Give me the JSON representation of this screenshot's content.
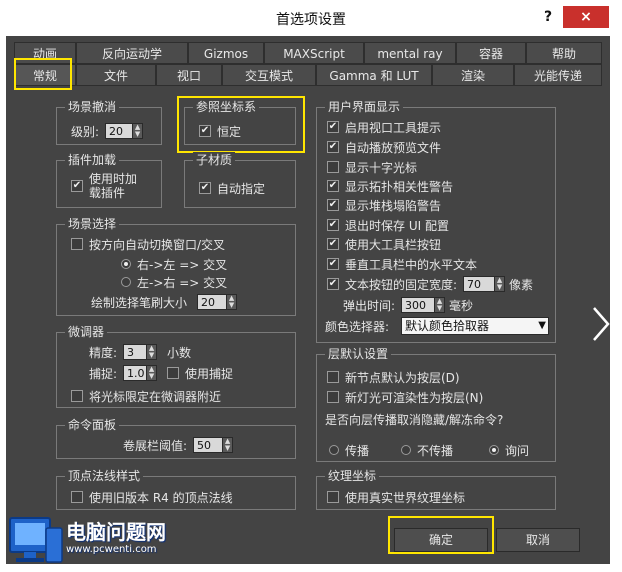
{
  "window": {
    "title": "首选项设置",
    "help_label": "?",
    "close_label": "×"
  },
  "tabs": {
    "row1": [
      "动画",
      "反向运动学",
      "Gizmos",
      "MAXScript",
      "mental ray",
      "容器",
      "帮助"
    ],
    "row2": [
      "常规",
      "文件",
      "视口",
      "交互模式",
      "Gamma 和 LUT",
      "渲染",
      "光能传递"
    ],
    "active": "常规"
  },
  "scene_undo": {
    "title": "场景撤消",
    "level_label": "级别:",
    "level_value": "20"
  },
  "ref_coord": {
    "title": "参照坐标系",
    "constant_label": "恒定",
    "constant_checked": true
  },
  "plugin_load": {
    "title": "插件加载",
    "load_on_use_label_1": "使用时加",
    "load_on_use_label_2": "载插件",
    "checked": true
  },
  "sub_material": {
    "title": "子材质",
    "auto_assign_label": "自动指定",
    "checked": true
  },
  "scene_selection": {
    "title": "场景选择",
    "auto_switch_label": "按方向自动切换窗口/交叉",
    "auto_switch_checked": false,
    "right_left_label": "右->左 => 交叉",
    "left_right_label": "左->右 => 交叉",
    "selected_radio": "right_left",
    "brush_size_label": "绘制选择笔刷大小",
    "brush_size_value": "20"
  },
  "spinners": {
    "title": "微调器",
    "precision_label": "精度:",
    "precision_value": "3",
    "decimals_label": "小数",
    "snap_label": "捕捉:",
    "snap_value": "1.0",
    "use_snap_label": "使用捕捉",
    "use_snap_checked": false,
    "wrap_label": "将光标限定在微调器附近",
    "wrap_checked": false
  },
  "command_panel": {
    "title": "命令面板",
    "rollout_label": "卷展栏阈值:",
    "rollout_value": "50"
  },
  "vertex_normal": {
    "title": "顶点法线样式",
    "legacy_label": "使用旧版本 R4 的顶点法线",
    "checked": false
  },
  "ui_display": {
    "title": "用户界面显示",
    "items": [
      {
        "label": "启用视口工具提示",
        "checked": true
      },
      {
        "label": "自动播放预览文件",
        "checked": true
      },
      {
        "label": "显示十字光标",
        "checked": false
      },
      {
        "label": "显示拓扑相关性警告",
        "checked": true
      },
      {
        "label": "显示堆栈塌陷警告",
        "checked": true
      },
      {
        "label": "退出时保存 UI 配置",
        "checked": true
      },
      {
        "label": "使用大工具栏按钮",
        "checked": true
      },
      {
        "label": "垂直工具栏中的水平文本",
        "checked": true
      }
    ],
    "fixed_width_label": "文本按钮的固定宽度:",
    "fixed_width_checked": true,
    "fixed_width_value": "70",
    "pixels_label": "像素",
    "flyout_label": "弹出时间:",
    "flyout_value": "300",
    "ms_label": "毫秒",
    "color_picker_label": "颜色选择器:",
    "color_picker_value": "默认颜色拾取器"
  },
  "layer_defaults": {
    "title": "层默认设置",
    "new_nodes_label": "新节点默认为按层(D)",
    "new_nodes_checked": false,
    "new_lights_label": "新灯光可渲染性为按层(N)",
    "new_lights_checked": false,
    "propagate_question": "是否向层传播取消隐藏/解冻命令?",
    "propagate_label": "传播",
    "no_propagate_label": "不传播",
    "ask_label": "询问",
    "selected_radio": "ask"
  },
  "texture_coords": {
    "title": "纹理坐标",
    "real_world_label": "使用真实世界纹理坐标",
    "checked": false
  },
  "buttons": {
    "ok_label": "确定",
    "cancel_label": "取消"
  },
  "watermark": {
    "text": "电脑问题网",
    "url": "www.pcwenti.com"
  },
  "colors": {
    "dialog_bg": "#444444",
    "highlight": "#ffe600",
    "close_red": "#c9302c"
  }
}
